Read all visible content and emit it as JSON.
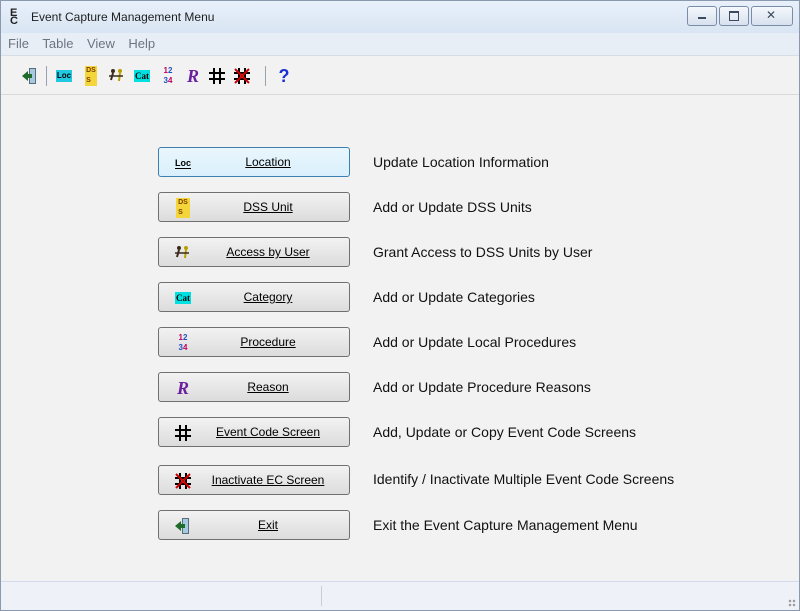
{
  "window": {
    "title": "Event Capture Management Menu",
    "icon_glyph": "E\nC"
  },
  "menubar": {
    "items": [
      "File",
      "Table",
      "View",
      "Help"
    ]
  },
  "toolbar": {
    "items": [
      {
        "name": "exit-icon",
        "glyph": "→"
      },
      {
        "name": "location-icon",
        "glyph": "Loc"
      },
      {
        "name": "dss-unit-icon",
        "glyph": "DSS"
      },
      {
        "name": "access-by-user-icon",
        "glyph": "★"
      },
      {
        "name": "category-icon",
        "glyph": "Cat"
      },
      {
        "name": "procedure-icon",
        "glyph": "123"
      },
      {
        "name": "reason-icon",
        "glyph": "R"
      },
      {
        "name": "event-code-screen-icon",
        "glyph": "#"
      },
      {
        "name": "inactivate-ec-screen-icon",
        "glyph": "#"
      },
      {
        "name": "help-icon",
        "glyph": "?"
      }
    ]
  },
  "buttons": [
    {
      "label": "Location",
      "description": "Update Location Information"
    },
    {
      "label": "DSS Unit",
      "description": "Add or Update DSS Units"
    },
    {
      "label": "Access by User",
      "description": "Grant Access to DSS Units by User"
    },
    {
      "label": "Category",
      "description": "Add or Update Categories"
    },
    {
      "label": "Procedure",
      "description": "Add or Update Local Procedures"
    },
    {
      "label": "Reason",
      "description": "Add or Update Procedure Reasons"
    },
    {
      "label": "Event Code Screen",
      "description": "Add, Update or Copy Event Code Screens"
    },
    {
      "label": "Inactivate EC Screen",
      "description": "Identify / Inactivate Multiple Event Code Screens"
    },
    {
      "label": "Exit",
      "description": "Exit the Event Capture Management Menu"
    }
  ],
  "colors": {
    "focus_border": "#3c7fb1",
    "location_bg": "#20c8e0",
    "dss_bg": "#f4d63a",
    "category_bg": "#00e0e0",
    "reason": "#6a1fa0",
    "inactivate": "#cc0000",
    "help": "#1a2fd0"
  }
}
